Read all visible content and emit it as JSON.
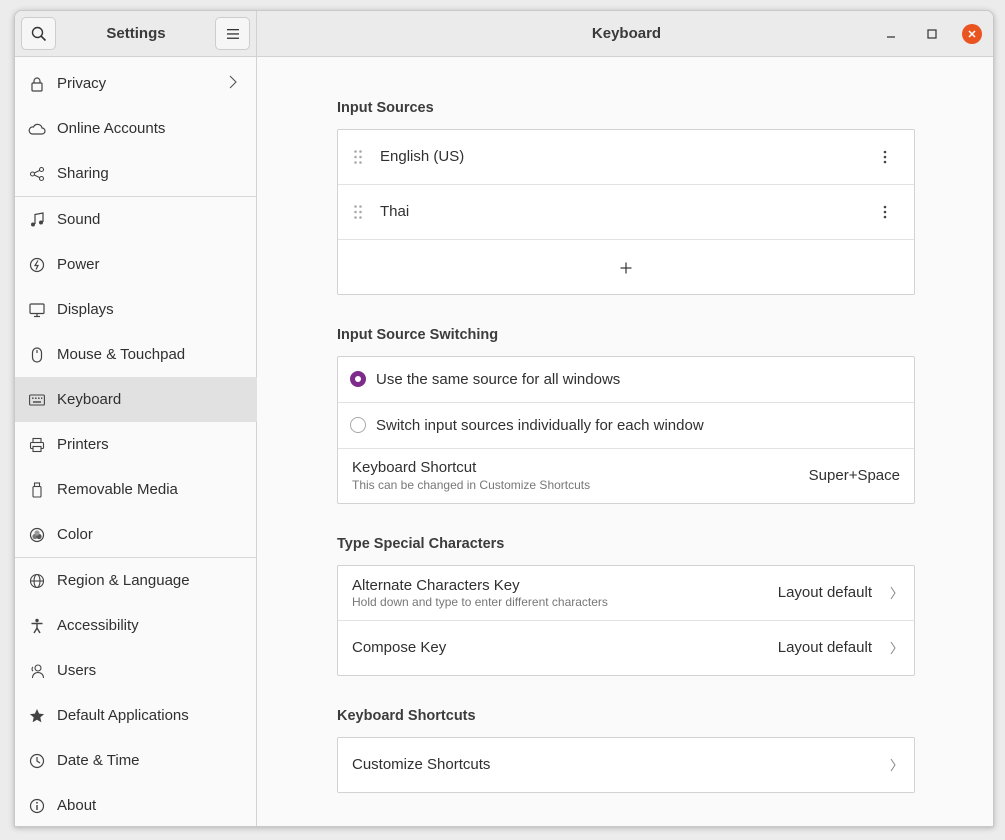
{
  "window": {
    "title": "Keyboard"
  },
  "sidebar": {
    "title": "Settings",
    "items": [
      {
        "label": "Privacy",
        "icon": "lock-icon"
      },
      {
        "label": "Online Accounts",
        "icon": "cloud-icon"
      },
      {
        "label": "Sharing",
        "icon": "share-icon"
      },
      {
        "label": "Sound",
        "icon": "music-note-icon"
      },
      {
        "label": "Power",
        "icon": "power-icon"
      },
      {
        "label": "Displays",
        "icon": "display-icon"
      },
      {
        "label": "Mouse & Touchpad",
        "icon": "mouse-icon"
      },
      {
        "label": "Keyboard",
        "icon": "keyboard-icon"
      },
      {
        "label": "Printers",
        "icon": "printer-icon"
      },
      {
        "label": "Removable Media",
        "icon": "removable-media-icon"
      },
      {
        "label": "Color",
        "icon": "color-icon"
      },
      {
        "label": "Region & Language",
        "icon": "globe-icon"
      },
      {
        "label": "Accessibility",
        "icon": "accessibility-icon"
      },
      {
        "label": "Users",
        "icon": "users-icon"
      },
      {
        "label": "Default Applications",
        "icon": "star-icon"
      },
      {
        "label": "Date & Time",
        "icon": "clock-icon"
      },
      {
        "label": "About",
        "icon": "info-icon"
      }
    ]
  },
  "input_sources": {
    "title": "Input Sources",
    "sources": [
      "English (US)",
      "Thai"
    ]
  },
  "switching": {
    "title": "Input Source Switching",
    "option_same": "Use the same source for all windows",
    "option_individual": "Switch input sources individually for each window",
    "selected": "same",
    "shortcut_label": "Keyboard Shortcut",
    "shortcut_sub": "This can be changed in Customize Shortcuts",
    "shortcut_value": "Super+Space"
  },
  "special_chars": {
    "title": "Type Special Characters",
    "alt_label": "Alternate Characters Key",
    "alt_sub": "Hold down and type to enter different characters",
    "alt_value": "Layout default",
    "compose_label": "Compose Key",
    "compose_value": "Layout default"
  },
  "shortcuts": {
    "title": "Keyboard Shortcuts",
    "customize_label": "Customize Shortcuts"
  },
  "colors": {
    "accent": "#7e2c8c",
    "close": "#e95420"
  }
}
